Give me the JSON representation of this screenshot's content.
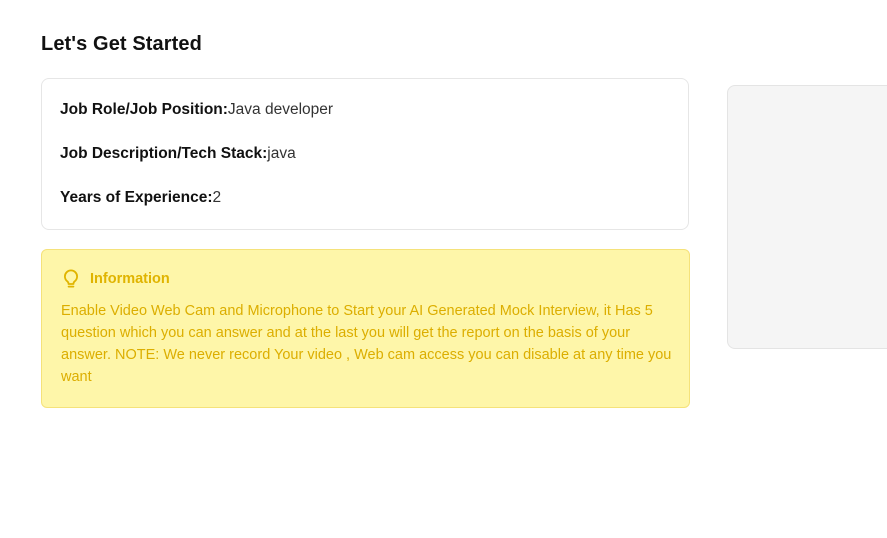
{
  "page": {
    "title": "Let's Get Started"
  },
  "details": {
    "job_role_label": "Job Role/Job Position:",
    "job_role_value": "Java developer",
    "job_desc_label": "Job Description/Tech Stack:",
    "job_desc_value": "java",
    "experience_label": "Years of Experience:",
    "experience_value": "2"
  },
  "info": {
    "icon": "lightbulb-icon",
    "title": "Information",
    "text": "Enable Video Web Cam and Microphone to Start your AI Generated Mock Interview, it Has 5 question which you can answer and at the last you will get the report on the basis of your answer. NOTE: We never record Your video , Web cam access you can disable at any time you want",
    "accent_color": "#e0b400",
    "background_color": "#fef6a9"
  },
  "webcam_panel": {
    "background_color": "#f5f5f5"
  }
}
